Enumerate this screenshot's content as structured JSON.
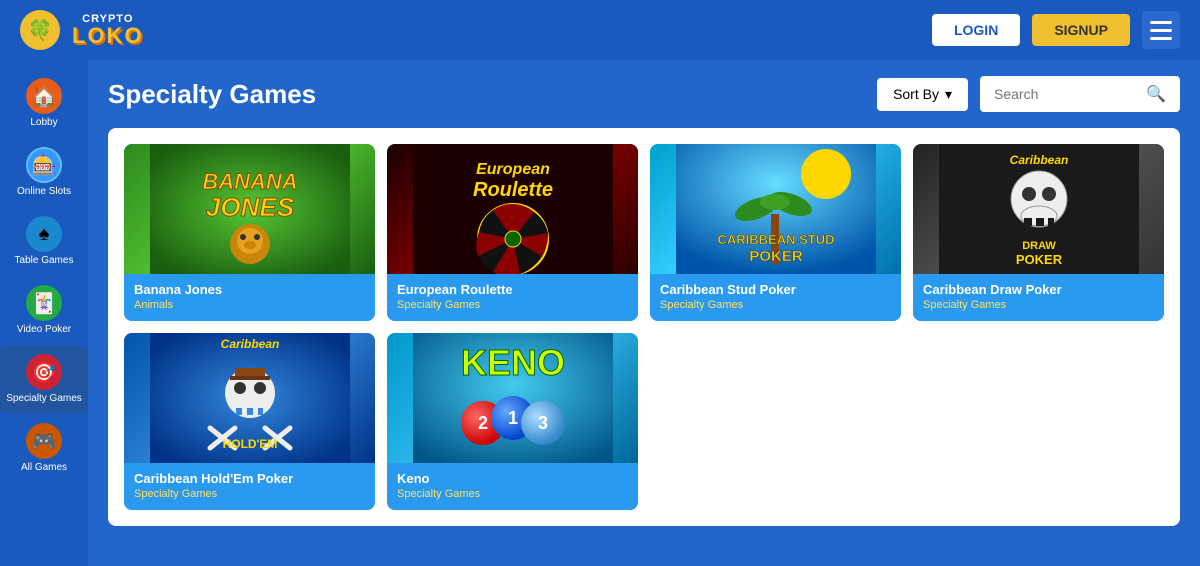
{
  "header": {
    "logo_crypto": "CRYPTO",
    "logo_loko": "LOKO",
    "login_label": "LOGIN",
    "signup_label": "SIGNUP"
  },
  "sidebar": {
    "items": [
      {
        "id": "lobby",
        "label": "Lobby",
        "icon": "🏠",
        "icon_class": "icon-lobby",
        "active": false
      },
      {
        "id": "online-slots",
        "label": "Online Slots",
        "icon": "🎰",
        "icon_class": "icon-slots",
        "active": false
      },
      {
        "id": "table-games",
        "label": "Table Games",
        "icon": "♠",
        "icon_class": "icon-table",
        "active": false
      },
      {
        "id": "video-poker",
        "label": "Video Poker",
        "icon": "🃏",
        "icon_class": "icon-video",
        "active": false
      },
      {
        "id": "specialty-games",
        "label": "Specialty Games",
        "icon": "🎯",
        "icon_class": "icon-specialty",
        "active": true
      },
      {
        "id": "all-games",
        "label": "All Games",
        "icon": "🎮",
        "icon_class": "icon-all",
        "active": false
      }
    ]
  },
  "page": {
    "title": "Specialty Games",
    "sort_label": "Sort By",
    "search_placeholder": "Search"
  },
  "games": [
    {
      "id": "banana-jones",
      "name": "Banana Jones",
      "category": "Animals",
      "thumb_type": "banana-jones",
      "thumb_text": "🐒"
    },
    {
      "id": "european-roulette",
      "name": "European Roulette",
      "category": "Specialty Games",
      "thumb_type": "euro-roulette",
      "thumb_text": "European Roulette"
    },
    {
      "id": "caribbean-stud-poker",
      "name": "Caribbean Stud Poker",
      "category": "Specialty Games",
      "thumb_type": "caribbean-stud",
      "thumb_text": "CARIBBEAN STUD POKER"
    },
    {
      "id": "caribbean-draw-poker",
      "name": "Caribbean Draw Poker",
      "category": "Specialty Games",
      "thumb_type": "caribbean-draw",
      "thumb_text": "Caribbean Draw POKER"
    },
    {
      "id": "caribbean-holdem-poker",
      "name": "Caribbean Hold'Em Poker",
      "category": "Specialty Games",
      "thumb_type": "caribbean-holdem",
      "thumb_text": "Caribbean Hold'Em"
    },
    {
      "id": "keno",
      "name": "Keno",
      "category": "Specialty Games",
      "thumb_type": "keno",
      "thumb_text": "KENO ② ① ③"
    }
  ]
}
